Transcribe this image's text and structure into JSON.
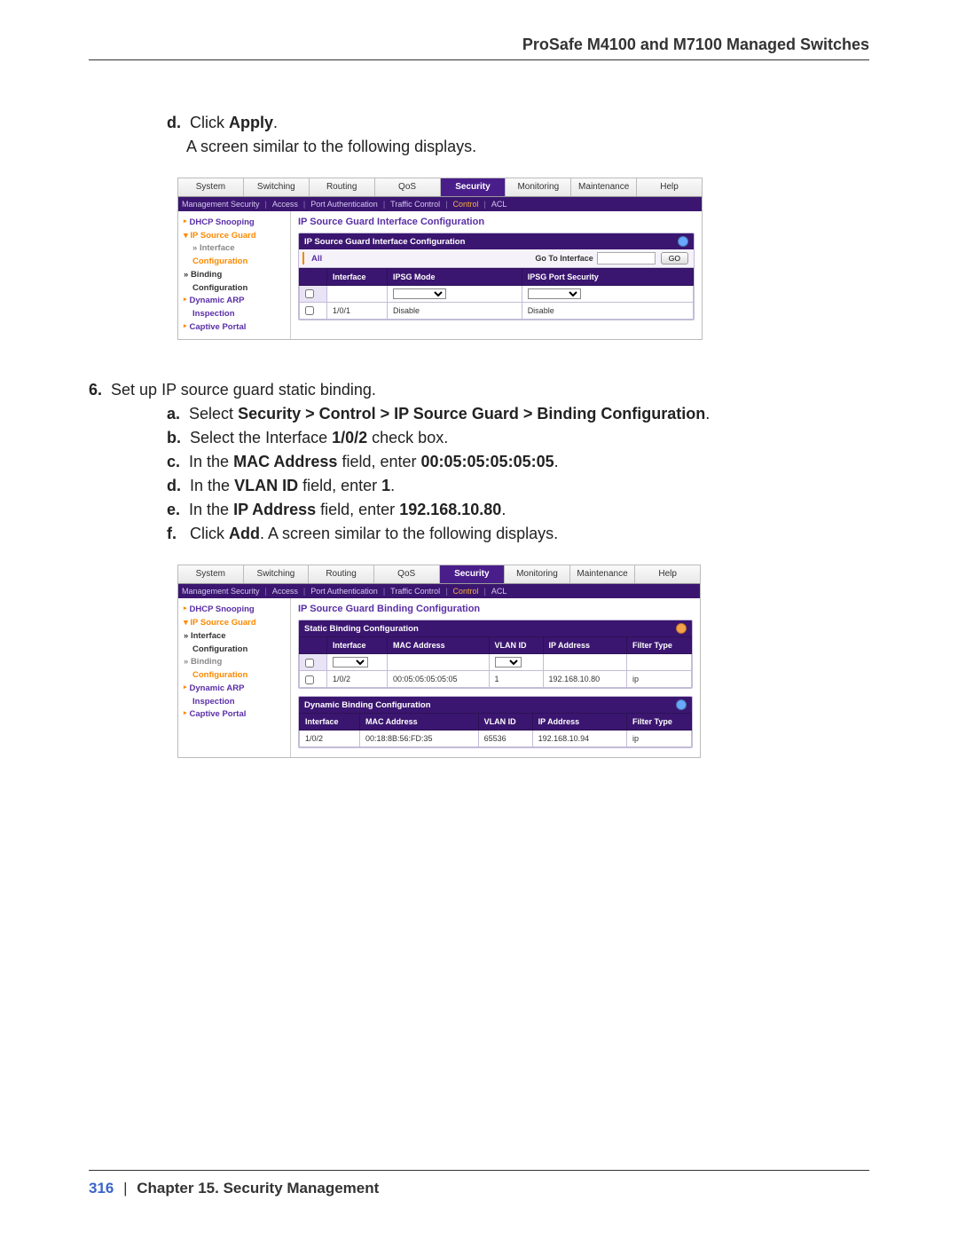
{
  "header": {
    "title": "ProSafe M4100 and M7100 Managed Switches"
  },
  "instructions": {
    "d_label": "d.",
    "d_text1": "Click ",
    "d_apply": "Apply",
    "d_text2": ".",
    "d_next": "A screen similar to the following displays.",
    "s6_num": "6.",
    "s6_text": "Set up IP source guard static binding.",
    "a_label": "a.",
    "a_text1": "Select ",
    "a_bold": "Security > Control > IP Source Guard > Binding Configuration",
    "a_text2": ".",
    "b_label": "b.",
    "b_text1": "Select the Interface ",
    "b_bold": "1/0/2",
    "b_text2": " check box.",
    "c_label": "c.",
    "c_text1": "In the ",
    "c_bold1": "MAC Address",
    "c_text2": " field, enter ",
    "c_bold2": "00:05:05:05:05:05",
    "c_text3": ".",
    "dd_label": "d.",
    "dd_text1": "In the ",
    "dd_bold": "VLAN ID",
    "dd_text2": " field, enter ",
    "dd_bold2": "1",
    "dd_text3": ".",
    "e_label": "e.",
    "e_text1": "In the ",
    "e_bold": "IP Address",
    "e_text2": " field, enter ",
    "e_bold2": "192.168.10.80",
    "e_text3": ".",
    "f_label": "f.",
    "f_text1": "Click ",
    "f_bold": "Add",
    "f_text2": ". A screen similar to the following displays."
  },
  "topTabs": [
    "System",
    "Switching",
    "Routing",
    "QoS",
    "Security",
    "Monitoring",
    "Maintenance",
    "Help"
  ],
  "subnav": {
    "items": [
      "Management Security",
      "Access",
      "Port Authentication",
      "Traffic Control"
    ],
    "control": "Control",
    "acl": "ACL",
    "sep": "|"
  },
  "ss1": {
    "sidebar": {
      "dhcp": "DHCP Snooping",
      "ipsg": "IP Source Guard",
      "interface": "Interface",
      "configuration": "Configuration",
      "binding": "Binding",
      "bconfig": "Configuration",
      "darp": "Dynamic ARP",
      "inspection": "Inspection",
      "captive": "Captive Portal"
    },
    "panelTitle": "IP Source Guard Interface Configuration",
    "groupHead": "IP Source Guard Interface Configuration",
    "tabAll": "All",
    "goTo": "Go To Interface",
    "goBtn": "GO",
    "headers": {
      "iface": "Interface",
      "mode": "IPSG Mode",
      "port": "IPSG Port Security"
    },
    "row": {
      "iface": "1/0/1",
      "mode": "Disable",
      "port": "Disable"
    }
  },
  "ss2": {
    "sidebar": {
      "dhcp": "DHCP Snooping",
      "ipsg": "IP Source Guard",
      "interface": "Interface",
      "configuration": "Configuration",
      "binding": "Binding",
      "bconfig": "Configuration",
      "darp": "Dynamic ARP",
      "inspection": "Inspection",
      "captive": "Captive Portal"
    },
    "panelTitle": "IP Source Guard Binding Configuration",
    "group1Head": "Static Binding Configuration",
    "headers1": {
      "iface": "Interface",
      "mac": "MAC Address",
      "vlan": "VLAN ID",
      "ip": "IP Address",
      "filter": "Filter Type"
    },
    "row1": {
      "iface": "1/0/2",
      "mac": "00:05:05:05:05:05",
      "vlan": "1",
      "ip": "192.168.10.80",
      "filter": "ip"
    },
    "group2Head": "Dynamic Binding Configuration",
    "headers2": {
      "iface": "Interface",
      "mac": "MAC Address",
      "vlan": "VLAN ID",
      "ip": "IP Address",
      "filter": "Filter Type"
    },
    "row2": {
      "iface": "1/0/2",
      "mac": "00:18:8B:56:FD:35",
      "vlan": "65536",
      "ip": "192.168.10.94",
      "filter": "ip"
    }
  },
  "footer": {
    "page": "316",
    "sep": "|",
    "chapter": "Chapter 15.  Security Management"
  }
}
